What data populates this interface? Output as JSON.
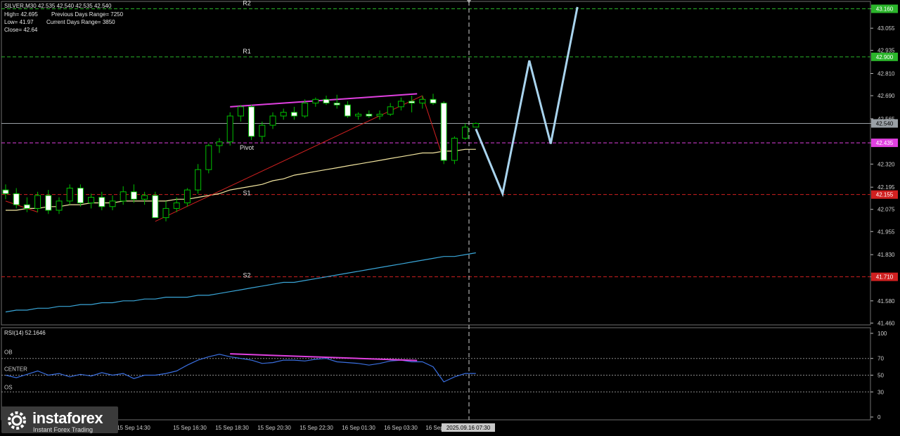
{
  "header": {
    "symbol_line": "SILVER,M30  42.535 42.540 42.535 42.540",
    "high_line": "High= 42.695",
    "low_line": "Low= 41.97",
    "close_line": "Close= 42.64",
    "prev_range": "Previous Days Range= 7250",
    "curr_range": "Current Days Range= 3850"
  },
  "logo": {
    "name": "instaforex",
    "tagline": "Instant Forex Trading",
    "icon": "gear-logo-icon"
  },
  "colors": {
    "background": "#000000",
    "bull_candle": "#000000",
    "bear_candle": "#ffffff",
    "candle_outline": "#00c000",
    "ma_fast": "#f3e6a0",
    "ma_slow": "#3aa6d8",
    "forecast": "#a9d4ee",
    "divergence": "#e040e0",
    "trendline": "#d02020",
    "rsi": "#3a6fe0",
    "level_green": "#2bb52b",
    "level_pivot": "#e040e0",
    "level_red": "#d02020",
    "current_price": "#9aa0a6"
  },
  "chart_data": {
    "type": "candlestick",
    "symbol": "SILVER,M30",
    "ylim": [
      41.45,
      43.2
    ],
    "y_ticks": [
      "43.160",
      "43.055",
      "42.935",
      "42.810",
      "42.690",
      "42.565",
      "42.540",
      "42.435",
      "42.320",
      "42.195",
      "42.075",
      "41.955",
      "41.830",
      "41.710",
      "41.580",
      "41.460"
    ],
    "x_ticks": [
      "15 Sep 14:30",
      "15 Sep 16:30",
      "15 Sep 18:30",
      "15 Sep 20:30",
      "15 Sep 22:30",
      "16 Sep 01:30",
      "16 Sep 03:30",
      "16 Sep"
    ],
    "cursor_time": "2025.09.16 07:30",
    "levels": [
      {
        "label": "R2",
        "value": 43.16,
        "color": "green",
        "tag": "43.160"
      },
      {
        "label": "R1",
        "value": 42.9,
        "color": "green",
        "tag": "42.900"
      },
      {
        "label": "",
        "value": 42.54,
        "color": "gray",
        "tag": "42.540"
      },
      {
        "label": "Pivot",
        "value": 42.435,
        "color": "pivot",
        "tag": "42.435"
      },
      {
        "label": "S1",
        "value": 42.155,
        "color": "red",
        "tag": "42.155"
      },
      {
        "label": "S2",
        "value": 41.71,
        "color": "red",
        "tag": "41.710"
      }
    ],
    "candles": [
      {
        "o": 42.18,
        "h": 42.21,
        "l": 42.13,
        "c": 42.16
      },
      {
        "o": 42.16,
        "h": 42.19,
        "l": 42.08,
        "c": 42.1
      },
      {
        "o": 42.1,
        "h": 42.14,
        "l": 42.06,
        "c": 42.08
      },
      {
        "o": 42.08,
        "h": 42.17,
        "l": 42.06,
        "c": 42.15
      },
      {
        "o": 42.15,
        "h": 42.18,
        "l": 42.05,
        "c": 42.07
      },
      {
        "o": 42.07,
        "h": 42.14,
        "l": 42.05,
        "c": 42.12
      },
      {
        "o": 42.12,
        "h": 42.21,
        "l": 42.1,
        "c": 42.19
      },
      {
        "o": 42.19,
        "h": 42.21,
        "l": 42.09,
        "c": 42.11
      },
      {
        "o": 42.11,
        "h": 42.16,
        "l": 42.08,
        "c": 42.14
      },
      {
        "o": 42.14,
        "h": 42.17,
        "l": 42.07,
        "c": 42.09
      },
      {
        "o": 42.09,
        "h": 42.15,
        "l": 42.07,
        "c": 42.12
      },
      {
        "o": 42.12,
        "h": 42.2,
        "l": 42.1,
        "c": 42.17
      },
      {
        "o": 42.17,
        "h": 42.21,
        "l": 42.11,
        "c": 42.13
      },
      {
        "o": 42.13,
        "h": 42.17,
        "l": 42.1,
        "c": 42.15
      },
      {
        "o": 42.15,
        "h": 42.17,
        "l": 42.09,
        "c": 42.03
      },
      {
        "o": 42.03,
        "h": 42.12,
        "l": 42.01,
        "c": 42.08
      },
      {
        "o": 42.08,
        "h": 42.14,
        "l": 42.06,
        "c": 42.11
      },
      {
        "o": 42.11,
        "h": 42.19,
        "l": 42.09,
        "c": 42.18
      },
      {
        "o": 42.18,
        "h": 42.32,
        "l": 42.16,
        "c": 42.29
      },
      {
        "o": 42.29,
        "h": 42.43,
        "l": 42.27,
        "c": 42.42
      },
      {
        "o": 42.42,
        "h": 42.46,
        "l": 42.38,
        "c": 42.44
      },
      {
        "o": 42.44,
        "h": 42.6,
        "l": 42.42,
        "c": 42.58
      },
      {
        "o": 42.58,
        "h": 42.64,
        "l": 42.55,
        "c": 42.63
      },
      {
        "o": 42.63,
        "h": 42.64,
        "l": 42.45,
        "c": 42.47
      },
      {
        "o": 42.47,
        "h": 42.55,
        "l": 42.44,
        "c": 42.53
      },
      {
        "o": 42.53,
        "h": 42.6,
        "l": 42.51,
        "c": 42.58
      },
      {
        "o": 42.58,
        "h": 42.62,
        "l": 42.56,
        "c": 42.6
      },
      {
        "o": 42.6,
        "h": 42.63,
        "l": 42.56,
        "c": 42.58
      },
      {
        "o": 42.58,
        "h": 42.67,
        "l": 42.57,
        "c": 42.65
      },
      {
        "o": 42.65,
        "h": 42.68,
        "l": 42.63,
        "c": 42.67
      },
      {
        "o": 42.67,
        "h": 42.69,
        "l": 42.64,
        "c": 42.65
      },
      {
        "o": 42.65,
        "h": 42.695,
        "l": 42.62,
        "c": 42.64
      },
      {
        "o": 42.64,
        "h": 42.66,
        "l": 42.57,
        "c": 42.58
      },
      {
        "o": 42.58,
        "h": 42.6,
        "l": 42.56,
        "c": 42.59
      },
      {
        "o": 42.59,
        "h": 42.61,
        "l": 42.57,
        "c": 42.58
      },
      {
        "o": 42.58,
        "h": 42.61,
        "l": 42.56,
        "c": 42.59
      },
      {
        "o": 42.59,
        "h": 42.65,
        "l": 42.58,
        "c": 42.63
      },
      {
        "o": 42.63,
        "h": 42.68,
        "l": 42.61,
        "c": 42.66
      },
      {
        "o": 42.66,
        "h": 42.69,
        "l": 42.6,
        "c": 42.65
      },
      {
        "o": 42.65,
        "h": 42.69,
        "l": 42.62,
        "c": 42.67
      },
      {
        "o": 42.67,
        "h": 42.7,
        "l": 42.64,
        "c": 42.65
      },
      {
        "o": 42.65,
        "h": 42.66,
        "l": 42.32,
        "c": 42.34
      },
      {
        "o": 42.34,
        "h": 42.47,
        "l": 42.32,
        "c": 42.46
      },
      {
        "o": 42.46,
        "h": 42.54,
        "l": 42.45,
        "c": 42.52
      },
      {
        "o": 42.52,
        "h": 42.545,
        "l": 42.52,
        "c": 42.54
      }
    ],
    "ma_fast": [
      42.07,
      42.07,
      42.08,
      42.08,
      42.09,
      42.09,
      42.1,
      42.1,
      42.11,
      42.11,
      42.11,
      42.12,
      42.12,
      42.12,
      42.12,
      42.12,
      42.13,
      42.13,
      42.14,
      42.15,
      42.16,
      42.18,
      42.19,
      42.2,
      42.21,
      42.23,
      42.24,
      42.26,
      42.27,
      42.28,
      42.29,
      42.3,
      42.31,
      42.32,
      42.33,
      42.34,
      42.35,
      42.36,
      42.37,
      42.38,
      42.38,
      42.39,
      42.39,
      42.4,
      42.4
    ],
    "ma_slow": [
      41.52,
      41.53,
      41.53,
      41.54,
      41.54,
      41.55,
      41.55,
      41.56,
      41.56,
      41.57,
      41.57,
      41.58,
      41.58,
      41.59,
      41.59,
      41.6,
      41.6,
      41.6,
      41.61,
      41.61,
      41.62,
      41.63,
      41.64,
      41.65,
      41.66,
      41.67,
      41.68,
      41.68,
      41.69,
      41.7,
      41.71,
      41.72,
      41.73,
      41.74,
      41.75,
      41.76,
      41.77,
      41.78,
      41.79,
      41.8,
      41.81,
      41.82,
      41.82,
      41.83,
      41.84
    ],
    "forecast": [
      [
        44,
        42.51
      ],
      [
        46.5,
        42.16
      ],
      [
        49,
        42.88
      ],
      [
        51,
        42.43
      ],
      [
        53.5,
        43.17
      ]
    ],
    "rsi": {
      "label": "RSI(14) 52.1646",
      "ylim": [
        0,
        100
      ],
      "ticks": [
        "100",
        "70",
        "50",
        "30",
        "0"
      ],
      "zones": [
        {
          "label": "OB",
          "value": 70
        },
        {
          "label": "CENTER",
          "value": 50
        },
        {
          "label": "OS",
          "value": 30
        }
      ],
      "values": [
        50,
        47,
        51,
        55,
        50,
        52,
        48,
        51,
        49,
        53,
        50,
        52,
        46,
        50,
        50,
        52,
        55,
        62,
        68,
        72,
        75,
        72,
        70,
        68,
        64,
        65,
        68,
        68,
        67,
        69,
        70,
        66,
        65,
        64,
        62,
        64,
        67,
        68,
        66,
        66,
        60,
        42,
        48,
        52,
        52
      ]
    }
  }
}
